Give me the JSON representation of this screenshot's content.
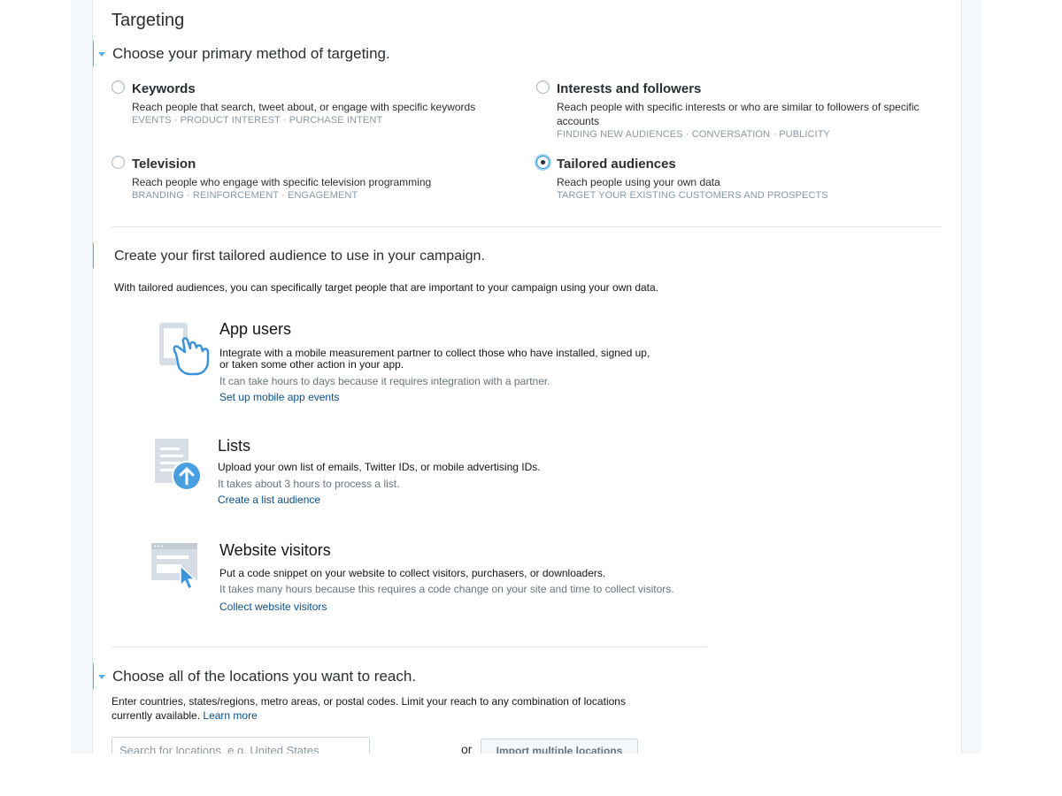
{
  "targeting": {
    "title": "Targeting",
    "primary_heading": "Choose your primary method of targeting.",
    "options": [
      {
        "title": "Keywords",
        "description": "Reach people that search, tweet about, or engage with specific keywords",
        "tags": "EVENTS · PRODUCT INTEREST · PURCHASE INTENT",
        "selected": false
      },
      {
        "title": "Interests and followers",
        "description_line1": "Reach people with specific interests or who are similar to followers of specific",
        "description_line2": "accounts",
        "tags": "FINDING NEW AUDIENCES · CONVERSATION · PUBLICITY",
        "selected": false
      },
      {
        "title": "Television",
        "description": "Reach people who engage with specific television programming",
        "tags": "BRANDING · REINFORCEMENT · ENGAGEMENT",
        "selected": false
      },
      {
        "title": "Tailored audiences",
        "description": "Reach people using your own data",
        "tags": "TARGET YOUR EXISTING CUSTOMERS AND PROSPECTS",
        "selected": true
      }
    ]
  },
  "tailored": {
    "heading": "Create your first tailored audience to use in your campaign.",
    "intro": "With tailored audiences, you can specifically target people that are important to your campaign using your own data.",
    "audiences": [
      {
        "icon": "hand-tapping-phone-icon",
        "title": "App users",
        "desc_line1": "Integrate with a mobile measurement partner to collect those who have installed, signed up,",
        "desc_line2": "or taken some other action in your app.",
        "note": "It can take hours to days because it requires integration with a partner.",
        "link": "Set up mobile app events"
      },
      {
        "icon": "list-upload-icon",
        "title": "Lists",
        "desc_line1": "Upload your own list of emails, Twitter IDs, or mobile advertising IDs.",
        "note": "It takes about 3 hours to process a list.",
        "link": "Create a list audience"
      },
      {
        "icon": "browser-cursor-icon",
        "title": "Website visitors",
        "desc_line1": "Put a code snippet on your website to collect visitors, purchasers, or downloaders.",
        "note": "It takes many hours because this requires a code change on your site and time to collect visitors.",
        "link": "Collect website visitors"
      }
    ]
  },
  "locations": {
    "heading": "Choose all of the locations you want to reach.",
    "desc_line1": "Enter countries, states/regions, metro areas, or postal codes. Limit your reach to any combination of locations",
    "desc_line2": "currently available.",
    "learn_more": "Learn more",
    "search_placeholder": "Search for locations, e.g. United States",
    "or_label": "or",
    "import_button": "Import multiple locations"
  },
  "colors": {
    "accent": "#55acee",
    "link": "#0c4f87",
    "selected_radio_glow": "#a5d4f5"
  }
}
